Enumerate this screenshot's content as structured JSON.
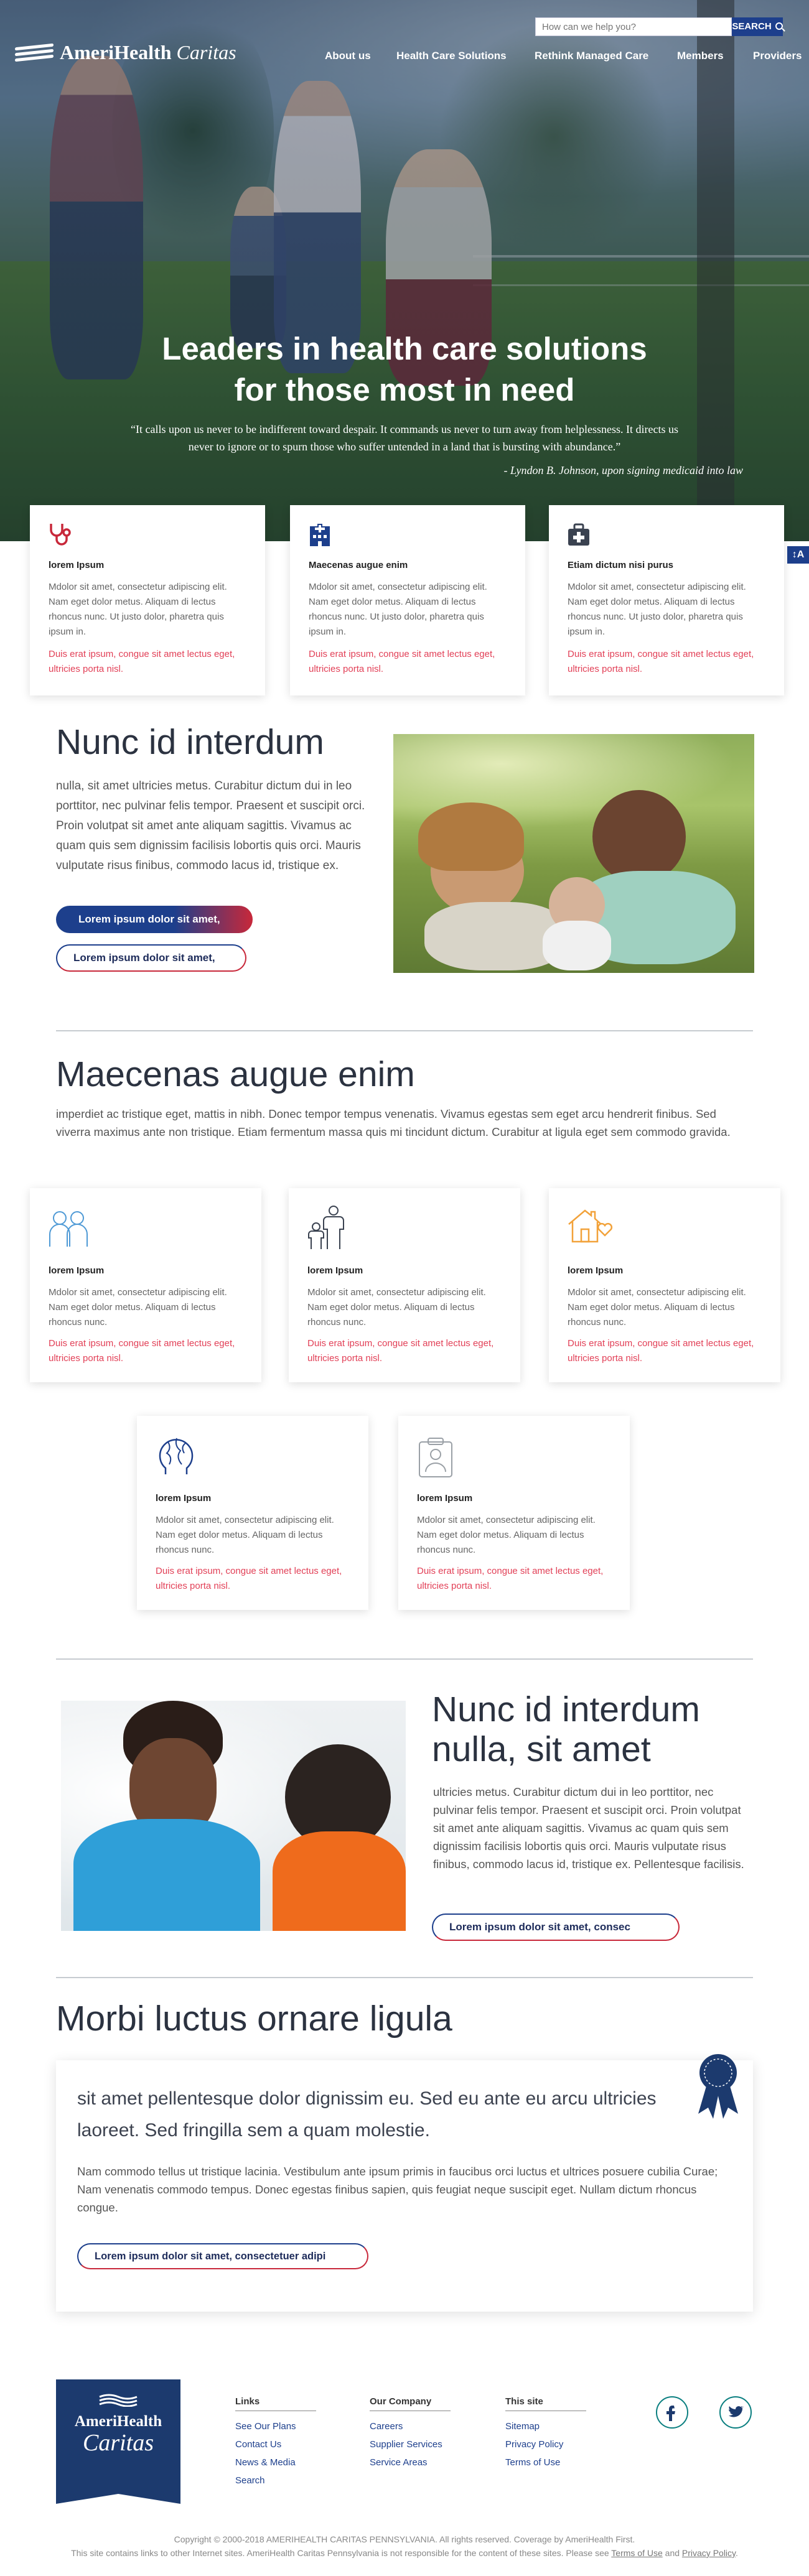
{
  "brand": {
    "name_bold": "AmeriHealth",
    "name_italic": "Caritas"
  },
  "header": {
    "search_placeholder": "How can we help you?",
    "search_button": "SEARCH",
    "nav": [
      "About us",
      "Health Care Solutions",
      "Rethink Managed Care",
      "Members",
      "Providers"
    ]
  },
  "hero": {
    "title_line1": "Leaders in health care solutions",
    "title_line2": "for those most in need",
    "quote_line1": "“It calls upon us never to be indifferent toward despair. It commands us never to turn away from helplessness. It directs us",
    "quote_line2": "never to ignore or to spurn those who suffer untended in a land that is bursting with abundance.”",
    "attribution": "- Lyndon B. Johnson, upon signing medicaid into law"
  },
  "accessibility_label": "↕A",
  "top_cards": [
    {
      "icon": "stethoscope-icon",
      "title": "lorem Ipsum",
      "desc": "Mdolor sit amet, consectetur adipiscing elit. Nam eget dolor metus. Aliquam di lectus rhoncus nunc. Ut justo dolor, pharetra quis ipsum in.",
      "link": "Duis erat ipsum, congue sit amet lectus eget, ultricies porta nisl."
    },
    {
      "icon": "hospital-building-icon",
      "title": "Maecenas augue enim",
      "desc": "Mdolor sit amet, consectetur adipiscing elit. Nam eget dolor metus. Aliquam di lectus rhoncus nunc. Ut justo dolor, pharetra quis ipsum in.",
      "link": "Duis erat ipsum, congue sit amet lectus eget, ultricies porta nisl."
    },
    {
      "icon": "medical-kit-icon",
      "title": "Etiam dictum nisi purus",
      "desc": "Mdolor sit amet, consectetur adipiscing elit. Nam eget dolor metus. Aliquam di lectus rhoncus nunc. Ut justo dolor, pharetra quis ipsum in.",
      "link": "Duis erat ipsum, congue sit amet lectus eget, ultricies porta nisl."
    }
  ],
  "section1": {
    "title": "Nunc id interdum",
    "body": "nulla, sit amet ultricies metus. Curabitur dictum dui in leo porttitor, nec pulvinar felis tempor. Praesent et suscipit orci. Proin volutpat sit amet ante aliquam sagittis. Vivamus ac quam quis sem dignissim facilisis lobortis quis orci. Mauris vulputate risus finibus, commodo lacus id, tristique ex.",
    "btn_primary": "Lorem ipsum dolor sit amet,",
    "btn_secondary": "Lorem ipsum dolor sit amet,"
  },
  "section2": {
    "title": "Maecenas augue enim",
    "body": "imperdiet ac tristique eget, mattis in nibh. Donec tempor tempus venenatis. Vivamus egestas sem eget arcu hendrerit finibus. Sed viverra maximus ante non tristique. Etiam fermentum massa quis mi tincidunt dictum. Curabitur at ligula eget sem commodo gravida.",
    "cards": [
      {
        "icon": "people-icon",
        "title": "lorem Ipsum",
        "desc": "Mdolor sit amet, consectetur adipiscing elit. Nam eget dolor metus. Aliquam di lectus rhoncus nunc.",
        "link": "Duis erat ipsum, congue sit amet lectus eget, ultricies porta nisl."
      },
      {
        "icon": "family-icon",
        "title": "lorem Ipsum",
        "desc": "Mdolor sit amet, consectetur adipiscing elit. Nam eget dolor metus. Aliquam di lectus rhoncus nunc.",
        "link": "Duis erat ipsum, congue sit amet lectus eget, ultricies porta nisl."
      },
      {
        "icon": "home-heart-icon",
        "title": "lorem Ipsum",
        "desc": "Mdolor sit amet, consectetur adipiscing elit. Nam eget dolor metus. Aliquam di lectus rhoncus nunc.",
        "link": "Duis erat ipsum, congue sit amet lectus eget, ultricies porta nisl."
      },
      {
        "icon": "brain-icon",
        "title": "lorem Ipsum",
        "desc": "Mdolor sit amet, consectetur adipiscing elit. Nam eget dolor metus. Aliquam di lectus rhoncus nunc.",
        "link": "Duis erat ipsum, congue sit amet lectus eget, ultricies porta nisl."
      },
      {
        "icon": "medical-record-icon",
        "title": "lorem Ipsum",
        "desc": "Mdolor sit amet, consectetur adipiscing elit. Nam eget dolor metus. Aliquam di lectus rhoncus nunc.",
        "link": "Duis erat ipsum, congue sit amet lectus eget, ultricies porta nisl."
      }
    ]
  },
  "section3": {
    "title_line1": "Nunc id interdum",
    "title_line2": "nulla, sit amet",
    "body": "ultricies metus. Curabitur dictum dui in leo porttitor, nec pulvinar felis tempor. Praesent et suscipit orci. Proin volutpat sit amet ante aliquam sagittis. Vivamus ac quam quis sem dignissim facilisis lobortis quis orci. Mauris vulputate risus finibus, commodo lacus id, tristique ex. Pellentesque facilisis.",
    "btn": "Lorem ipsum dolor sit amet, consec"
  },
  "section4": {
    "title": "Morbi luctus ornare ligula",
    "lead": "sit amet pellentesque dolor dignissim eu. Sed eu ante eu arcu ultricies laoreet. Sed fringilla sem a quam molestie.",
    "body": "Nam commodo tellus ut tristique lacinia. Vestibulum ante ipsum primis in faucibus orci luctus et ultrices posuere cubilia Curae; Nam venenatis commodo tempus. Donec egestas finibus sapien, quis feugiat neque suscipit eget. Nullam dictum rhoncus congue.",
    "btn": "Lorem ipsum dolor sit amet, consectetuer adipi"
  },
  "footer": {
    "logo_line1": "AmeriHealth",
    "logo_line2": "Caritas",
    "links": {
      "heading": "Links",
      "items": [
        "See Our Plans",
        "Contact Us",
        "News & Media",
        "Search"
      ]
    },
    "company": {
      "heading": "Our Company",
      "items": [
        "Careers",
        "Supplier Services",
        "Service Areas"
      ]
    },
    "site": {
      "heading": "This site",
      "items": [
        "Sitemap",
        "Privacy Policy",
        "Terms of Use"
      ]
    },
    "copyright": "Copyright © 2000-2018 AMERIHEALTH CARITAS PENNSYLVANIA. All rights reserved. Coverage by AmeriHealth First.",
    "disclaimer": "This site contains links to other Internet sites. AmeriHealth Caritas Pennsylvania is not responsible for the content of these sites. Please see",
    "terms_link": "Terms of Use",
    "and": "and",
    "privacy_link": "Privacy Policy"
  },
  "colors": {
    "navy": "#1d3f8c",
    "red": "#c8283a",
    "link_red": "#e24057",
    "footer_navy": "#1c3a6e",
    "teal": "#0b7f80"
  }
}
